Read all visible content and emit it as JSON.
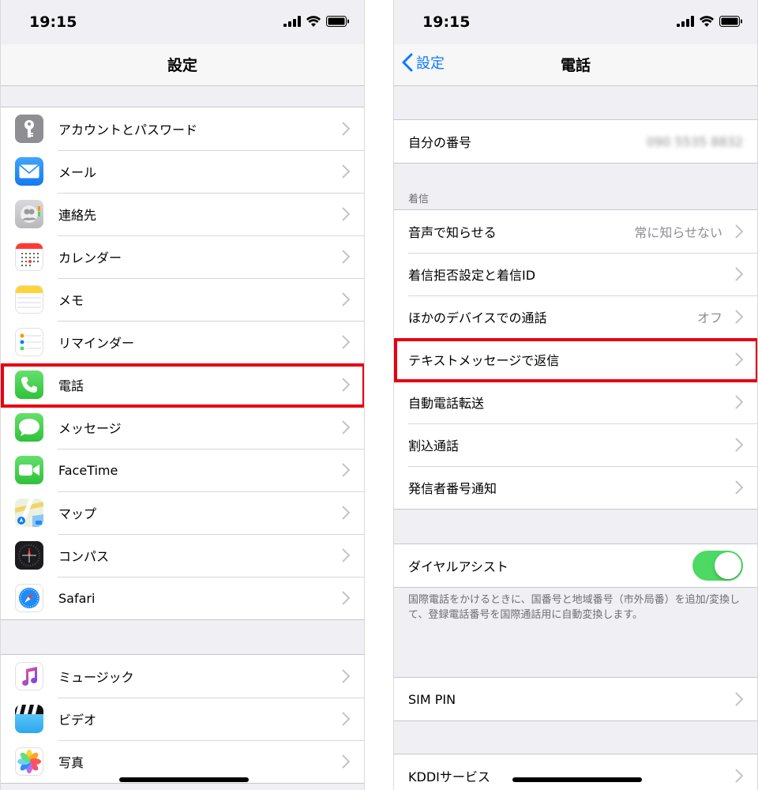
{
  "left_screen": {
    "status": {
      "time": "19:15"
    },
    "nav_title": "設定",
    "group1": [
      {
        "label": "アカウントとパスワード",
        "icon": "key-icon",
        "color": "#8e8e93"
      },
      {
        "label": "メール",
        "icon": "mail-icon",
        "color": "#1e8cf8"
      },
      {
        "label": "連絡先",
        "icon": "contacts-icon",
        "color": "#c7c7cc"
      },
      {
        "label": "カレンダー",
        "icon": "calendar-icon",
        "color": "#ffffff"
      },
      {
        "label": "メモ",
        "icon": "notes-icon",
        "color": "#ffffff"
      },
      {
        "label": "リマインダー",
        "icon": "reminders-icon",
        "color": "#ffffff"
      },
      {
        "label": "電話",
        "icon": "phone-icon",
        "color": "#4cd964"
      },
      {
        "label": "メッセージ",
        "icon": "messages-icon",
        "color": "#4cd964"
      },
      {
        "label": "FaceTime",
        "icon": "facetime-icon",
        "color": "#4cd964"
      },
      {
        "label": "マップ",
        "icon": "maps-icon",
        "color": "#e8f0e0"
      },
      {
        "label": "コンパス",
        "icon": "compass-icon",
        "color": "#1c1c1e"
      },
      {
        "label": "Safari",
        "icon": "safari-icon",
        "color": "#ffffff"
      }
    ],
    "group2": [
      {
        "label": "ミュージック",
        "icon": "music-icon",
        "color": "#ffffff"
      },
      {
        "label": "ビデオ",
        "icon": "video-icon",
        "color": "#5ac8fa"
      },
      {
        "label": "写真",
        "icon": "photos-icon",
        "color": "#ffffff"
      }
    ]
  },
  "right_screen": {
    "status": {
      "time": "19:15"
    },
    "back_label": "設定",
    "nav_title": "電話",
    "my_number": {
      "label": "自分の番号",
      "value": "090 5535 8832"
    },
    "incoming_header": "着信",
    "incoming": [
      {
        "label": "音声で知らせる",
        "value": "常に知らせない"
      },
      {
        "label": "着信拒否設定と着信ID",
        "value": ""
      },
      {
        "label": "ほかのデバイスでの通話",
        "value": "オフ"
      },
      {
        "label": "テキストメッセージで返信",
        "value": ""
      },
      {
        "label": "自動電話転送",
        "value": ""
      },
      {
        "label": "割込通話",
        "value": ""
      },
      {
        "label": "発信者番号通知",
        "value": ""
      }
    ],
    "dial_assist": {
      "label": "ダイヤルアシスト",
      "on": true
    },
    "dial_assist_note": "国際電話をかけるときに、国番号と地域番号（市外局番）を追加/変換して、登録電話番号を国際通話用に自動変換します。",
    "sim_pin": "SIM PIN",
    "kddi": "KDDIサービス"
  },
  "colors": {
    "accent": "#0a7aff",
    "highlight": "#e60012",
    "toggle_on": "#4cd964"
  }
}
